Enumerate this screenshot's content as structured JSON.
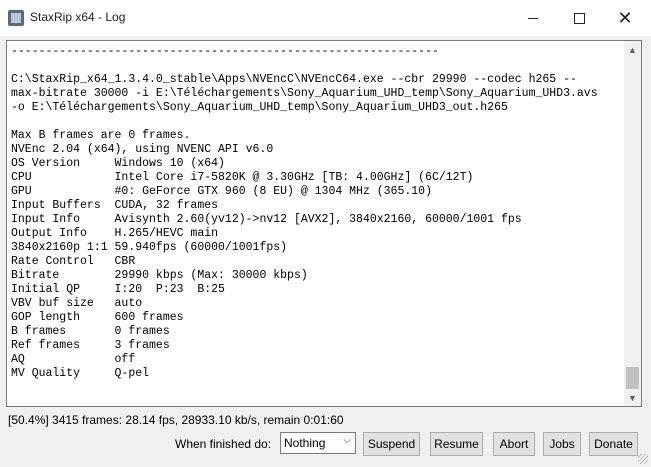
{
  "window": {
    "title": "StaxRip x64 - Log"
  },
  "log": {
    "lines": [
      "--------------------------------------------------------------",
      "",
      "C:\\StaxRip_x64_1.3.4.0_stable\\Apps\\NVEncC\\NVEncC64.exe --cbr 29990 --codec h265 --",
      "max-bitrate 30000 -i E:\\Téléchargements\\Sony_Aquarium_UHD_temp\\Sony_Aquarium_UHD3.avs",
      "-o E:\\Téléchargements\\Sony_Aquarium_UHD_temp\\Sony_Aquarium_UHD3_out.h265",
      "",
      "Max B frames are 0 frames.",
      "NVEnc 2.04 (x64), using NVENC API v6.0",
      "OS Version     Windows 10 (x64)",
      "CPU            Intel Core i7-5820K @ 3.30GHz [TB: 4.00GHz] (6C/12T)",
      "GPU            #0: GeForce GTX 960 (8 EU) @ 1304 MHz (365.10)",
      "Input Buffers  CUDA, 32 frames",
      "Input Info     Avisynth 2.60(yv12)->nv12 [AVX2], 3840x2160, 60000/1001 fps",
      "Output Info    H.265/HEVC main",
      "3840x2160p 1:1 59.940fps (60000/1001fps)",
      "Rate Control   CBR",
      "Bitrate        29990 kbps (Max: 30000 kbps)",
      "Initial QP     I:20  P:23  B:25",
      "VBV buf size   auto",
      "GOP length     600 frames",
      "B frames       0 frames",
      "Ref frames     3 frames",
      "AQ             off",
      "MV Quality     Q-pel"
    ]
  },
  "status": {
    "text": "[50.4%] 3415 frames: 28.14 fps, 28933.10 kb/s, remain 0:01:60"
  },
  "controls": {
    "finish_label": "When finished do:",
    "finish_value": "Nothing",
    "suspend": "Suspend",
    "resume": "Resume",
    "abort": "Abort",
    "jobs": "Jobs",
    "donate": "Donate"
  },
  "icons": {
    "app": "staxrip-app-icon",
    "minimize": "minimize-icon",
    "maximize": "maximize-icon",
    "close": "close-icon",
    "scroll_up": "scroll-up-arrow-icon",
    "scroll_down": "scroll-down-arrow-icon",
    "dropdown": "chevron-down-icon"
  }
}
